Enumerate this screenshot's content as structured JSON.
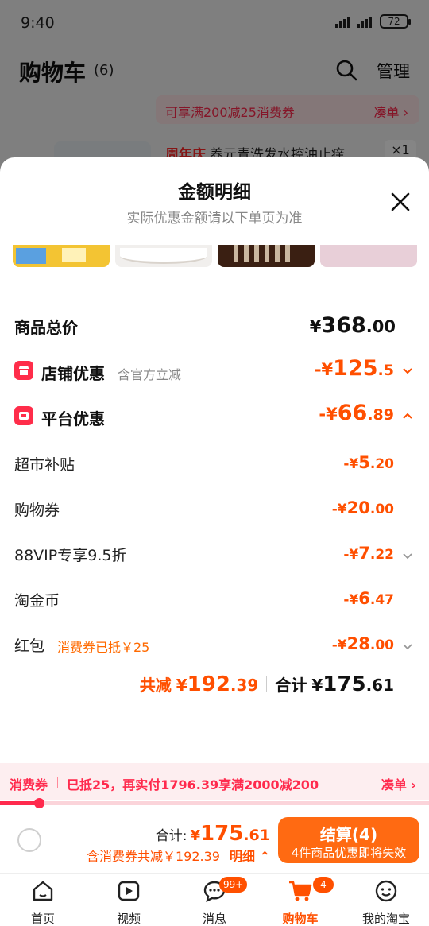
{
  "status_bar": {
    "time": "9:40",
    "battery": "72"
  },
  "background_page": {
    "title": "购物车",
    "count": "(6)",
    "manage": "管理",
    "coupon_banner": {
      "text": "可享满200减25消费券",
      "link": "凑单"
    },
    "item": {
      "tag": "周年庆",
      "name": "养元青洗发水控油止痒",
      "qty": "×1"
    }
  },
  "sheet": {
    "title": "金额明细",
    "subtitle": "实际优惠金额请以下单页为准",
    "total": {
      "label": "商品总价",
      "currency": "¥",
      "int": "368",
      "dec": ".00"
    },
    "store_discount": {
      "label": "店铺优惠",
      "note": "含官方立减",
      "prefix": "-¥",
      "int": "125",
      "dec": ".5"
    },
    "platform_discount": {
      "label": "平台优惠",
      "prefix": "-¥",
      "int": "66",
      "dec": ".89"
    },
    "items": [
      {
        "label": "超市补贴",
        "prefix": "-¥",
        "int": "5",
        "dec": ".20"
      },
      {
        "label": "购物券",
        "prefix": "-¥",
        "int": "20",
        "dec": ".00"
      },
      {
        "label": "88VIP专享9.5折",
        "prefix": "-¥",
        "int": "7",
        "dec": ".22"
      },
      {
        "label": "淘金币",
        "prefix": "-¥",
        "int": "6",
        "dec": ".47"
      },
      {
        "label": "红包",
        "note": "消费券已抵￥25",
        "prefix": "-¥",
        "int": "28",
        "dec": ".00"
      }
    ],
    "summary": {
      "reduce_label": "共减",
      "reduce_cur": "¥",
      "reduce_int": "192",
      "reduce_dec": ".39",
      "total_label": "合计",
      "total_cur": "¥",
      "total_int": "175",
      "total_dec": ".61"
    }
  },
  "coupon_strip": {
    "tag": "消费券",
    "text": "已抵25，再实付1796.39享满2000减200",
    "link": "凑单",
    "progress_fraction": 0.09
  },
  "checkout": {
    "total_label": "合计:",
    "currency": "¥",
    "total_int": "175",
    "total_dec": ".61",
    "sub_text": "含消费券共减￥192.39",
    "detail": "明细",
    "button_main": "结算(4)",
    "button_sub": "4件商品优惠即将失效"
  },
  "tabs": [
    {
      "label": "首页",
      "icon": "home-icon"
    },
    {
      "label": "视频",
      "icon": "video-icon"
    },
    {
      "label": "消息",
      "icon": "message-icon",
      "badge": "99+"
    },
    {
      "label": "购物车",
      "icon": "cart-icon",
      "badge": "4",
      "active": true
    },
    {
      "label": "我的淘宝",
      "icon": "profile-icon"
    }
  ],
  "colors": {
    "accent": "#ff4f00",
    "coupon_red": "#ff2a4d",
    "button": "#ff6a12"
  }
}
